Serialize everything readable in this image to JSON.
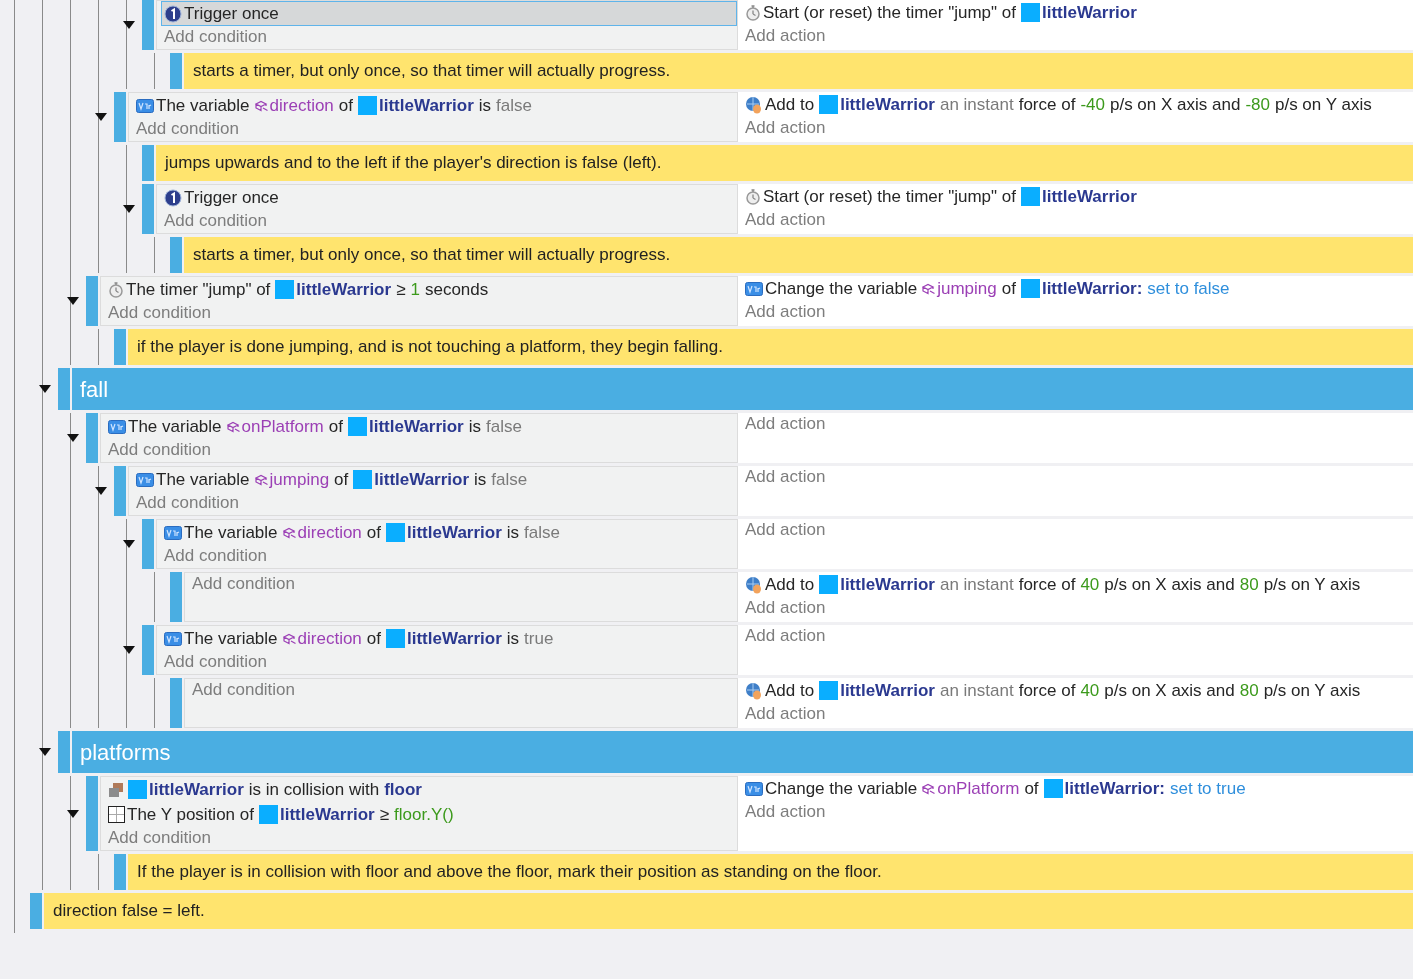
{
  "events": [
    {
      "children": [
        {
          "children": [
            {
              "children": [
                {
                  "children": [
                    {
                      "kind": "event",
                      "expanded": true,
                      "conditions": [
                        {
                          "kind": "trigger",
                          "selected": true,
                          "segments": [
                            {
                              "kind": "text",
                              "text": "Trigger once"
                            }
                          ]
                        }
                      ],
                      "add_condition": "Add condition",
                      "actions": [
                        {
                          "kind": "timer",
                          "selected": false,
                          "segments": [
                            {
                              "kind": "text",
                              "text": "Start (or reset) the timer \"jump\" of"
                            },
                            {
                              "kind": "object",
                              "text": "littleWarrior"
                            }
                          ]
                        }
                      ],
                      "add_action": "Add action",
                      "children": [
                        {
                          "kind": "comment",
                          "text": "starts a timer, but only once, so that timer will actually progress."
                        }
                      ]
                    }
                  ]
                },
                {
                  "kind": "event",
                  "expanded": true,
                  "conditions": [
                    {
                      "kind": "variable",
                      "selected": false,
                      "segments": [
                        {
                          "kind": "text",
                          "text": "The variable"
                        },
                        {
                          "kind": "variable",
                          "text": "direction"
                        },
                        {
                          "kind": "text",
                          "text": "of"
                        },
                        {
                          "kind": "object",
                          "text": "littleWarrior"
                        },
                        {
                          "kind": "text",
                          "text": "is"
                        },
                        {
                          "kind": "muted",
                          "text": "false"
                        }
                      ]
                    }
                  ],
                  "add_condition": "Add condition",
                  "actions": [
                    {
                      "kind": "force",
                      "selected": false,
                      "segments": [
                        {
                          "kind": "text",
                          "text": "Add to"
                        },
                        {
                          "kind": "object",
                          "text": "littleWarrior"
                        },
                        {
                          "kind": "muted",
                          "text": "an instant"
                        },
                        {
                          "kind": "text",
                          "text": "force of"
                        },
                        {
                          "kind": "number",
                          "text": "-40"
                        },
                        {
                          "kind": "text",
                          "text": "p/s on X axis and"
                        },
                        {
                          "kind": "number",
                          "text": "-80"
                        },
                        {
                          "kind": "text",
                          "text": "p/s on Y axis"
                        }
                      ]
                    }
                  ],
                  "add_action": "Add action",
                  "children": [
                    {
                      "kind": "comment",
                      "text": "jumps upwards and to the left if the player's direction is false (left)."
                    },
                    {
                      "kind": "event",
                      "expanded": true,
                      "conditions": [
                        {
                          "kind": "trigger",
                          "selected": false,
                          "segments": [
                            {
                              "kind": "text",
                              "text": "Trigger once"
                            }
                          ]
                        }
                      ],
                      "add_condition": "Add condition",
                      "actions": [
                        {
                          "kind": "timer",
                          "selected": false,
                          "segments": [
                            {
                              "kind": "text",
                              "text": "Start (or reset) the timer \"jump\" of"
                            },
                            {
                              "kind": "object",
                              "text": "littleWarrior"
                            }
                          ]
                        }
                      ],
                      "add_action": "Add action",
                      "children": [
                        {
                          "kind": "comment",
                          "text": "starts a timer, but only once, so that timer will actually progress."
                        }
                      ]
                    }
                  ]
                }
              ]
            },
            {
              "kind": "event",
              "expanded": true,
              "conditions": [
                {
                  "kind": "timer",
                  "selected": false,
                  "segments": [
                    {
                      "kind": "text",
                      "text": "The timer \"jump\" of"
                    },
                    {
                      "kind": "object",
                      "text": "littleWarrior"
                    },
                    {
                      "kind": "text",
                      "text": "≥"
                    },
                    {
                      "kind": "number",
                      "text": "1"
                    },
                    {
                      "kind": "text",
                      "text": "seconds"
                    }
                  ]
                }
              ],
              "add_condition": "Add condition",
              "actions": [
                {
                  "kind": "variable",
                  "selected": false,
                  "segments": [
                    {
                      "kind": "text",
                      "text": "Change the variable"
                    },
                    {
                      "kind": "variable",
                      "text": "jumping"
                    },
                    {
                      "kind": "text",
                      "text": "of"
                    },
                    {
                      "kind": "object",
                      "text": "littleWarrior:"
                    },
                    {
                      "kind": "value",
                      "text": "set to false"
                    }
                  ]
                }
              ],
              "add_action": "Add action",
              "children": [
                {
                  "kind": "comment",
                  "text": "if the player is done jumping, and is not touching a platform, they begin falling."
                }
              ]
            }
          ]
        },
        {
          "kind": "group",
          "text": "fall",
          "expanded": true,
          "children": [
            {
              "kind": "event",
              "expanded": true,
              "conditions": [
                {
                  "kind": "variable",
                  "selected": false,
                  "segments": [
                    {
                      "kind": "text",
                      "text": "The variable"
                    },
                    {
                      "kind": "variable",
                      "text": "onPlatform"
                    },
                    {
                      "kind": "text",
                      "text": "of"
                    },
                    {
                      "kind": "object",
                      "text": "littleWarrior"
                    },
                    {
                      "kind": "text",
                      "text": "is"
                    },
                    {
                      "kind": "muted",
                      "text": "false"
                    }
                  ]
                }
              ],
              "add_condition": "Add condition",
              "add_action": "Add action",
              "children": [
                {
                  "kind": "event",
                  "expanded": true,
                  "conditions": [
                    {
                      "kind": "variable",
                      "selected": false,
                      "segments": [
                        {
                          "kind": "text",
                          "text": "The variable"
                        },
                        {
                          "kind": "variable",
                          "text": "jumping"
                        },
                        {
                          "kind": "text",
                          "text": "of"
                        },
                        {
                          "kind": "object",
                          "text": "littleWarrior"
                        },
                        {
                          "kind": "text",
                          "text": "is"
                        },
                        {
                          "kind": "muted",
                          "text": "false"
                        }
                      ]
                    }
                  ],
                  "add_condition": "Add condition",
                  "add_action": "Add action",
                  "children": [
                    {
                      "kind": "event",
                      "expanded": true,
                      "conditions": [
                        {
                          "kind": "variable",
                          "selected": false,
                          "segments": [
                            {
                              "kind": "text",
                              "text": "The variable"
                            },
                            {
                              "kind": "variable",
                              "text": "direction"
                            },
                            {
                              "kind": "text",
                              "text": "of"
                            },
                            {
                              "kind": "object",
                              "text": "littleWarrior"
                            },
                            {
                              "kind": "text",
                              "text": "is"
                            },
                            {
                              "kind": "muted",
                              "text": "false"
                            }
                          ]
                        }
                      ],
                      "add_condition": "Add condition",
                      "add_action": "Add action",
                      "children": [
                        {
                          "kind": "event",
                          "add_condition": "Add condition",
                          "actions": [
                            {
                              "kind": "force",
                              "selected": false,
                              "segments": [
                                {
                                  "kind": "text",
                                  "text": "Add to"
                                },
                                {
                                  "kind": "object",
                                  "text": "littleWarrior"
                                },
                                {
                                  "kind": "muted",
                                  "text": "an instant"
                                },
                                {
                                  "kind": "text",
                                  "text": "force of"
                                },
                                {
                                  "kind": "number",
                                  "text": "40"
                                },
                                {
                                  "kind": "text",
                                  "text": "p/s on X axis and"
                                },
                                {
                                  "kind": "number",
                                  "text": "80"
                                },
                                {
                                  "kind": "text",
                                  "text": "p/s on Y axis"
                                }
                              ]
                            }
                          ],
                          "add_action": "Add action"
                        }
                      ]
                    },
                    {
                      "kind": "event",
                      "expanded": true,
                      "conditions": [
                        {
                          "kind": "variable",
                          "selected": false,
                          "segments": [
                            {
                              "kind": "text",
                              "text": "The variable"
                            },
                            {
                              "kind": "variable",
                              "text": "direction"
                            },
                            {
                              "kind": "text",
                              "text": "of"
                            },
                            {
                              "kind": "object",
                              "text": "littleWarrior"
                            },
                            {
                              "kind": "text",
                              "text": "is"
                            },
                            {
                              "kind": "muted",
                              "text": "true"
                            }
                          ]
                        }
                      ],
                      "add_condition": "Add condition",
                      "add_action": "Add action",
                      "children": [
                        {
                          "kind": "event",
                          "add_condition": "Add condition",
                          "actions": [
                            {
                              "kind": "force",
                              "selected": false,
                              "segments": [
                                {
                                  "kind": "text",
                                  "text": "Add to"
                                },
                                {
                                  "kind": "object",
                                  "text": "littleWarrior"
                                },
                                {
                                  "kind": "muted",
                                  "text": "an instant"
                                },
                                {
                                  "kind": "text",
                                  "text": "force of"
                                },
                                {
                                  "kind": "number",
                                  "text": "40"
                                },
                                {
                                  "kind": "text",
                                  "text": "p/s on X axis and"
                                },
                                {
                                  "kind": "number",
                                  "text": "80"
                                },
                                {
                                  "kind": "text",
                                  "text": "p/s on Y axis"
                                }
                              ]
                            }
                          ],
                          "add_action": "Add action"
                        }
                      ]
                    }
                  ]
                }
              ]
            }
          ]
        },
        {
          "kind": "group",
          "text": "platforms",
          "expanded": true,
          "children": [
            {
              "kind": "event",
              "expanded": true,
              "conditions": [
                {
                  "kind": "collision",
                  "selected": false,
                  "segments": [
                    {
                      "kind": "object",
                      "text": "littleWarrior"
                    },
                    {
                      "kind": "text",
                      "text": "is in collision with"
                    },
                    {
                      "kind": "objectref",
                      "text": "floor"
                    }
                  ]
                },
                {
                  "kind": "position",
                  "selected": false,
                  "segments": [
                    {
                      "kind": "text",
                      "text": "The Y position of"
                    },
                    {
                      "kind": "object",
                      "text": "littleWarrior"
                    },
                    {
                      "kind": "text",
                      "text": "≥"
                    },
                    {
                      "kind": "number",
                      "text": "floor.Y()"
                    }
                  ]
                }
              ],
              "add_condition": "Add condition",
              "actions": [
                {
                  "kind": "variable",
                  "selected": false,
                  "segments": [
                    {
                      "kind": "text",
                      "text": "Change the variable"
                    },
                    {
                      "kind": "variable",
                      "text": "onPlatform"
                    },
                    {
                      "kind": "text",
                      "text": "of"
                    },
                    {
                      "kind": "object",
                      "text": "littleWarrior:"
                    },
                    {
                      "kind": "value",
                      "text": "set to true"
                    }
                  ]
                }
              ],
              "add_action": "Add action",
              "children": [
                {
                  "kind": "comment",
                  "text": "If the player is in collision with floor and above the floor, mark their position as standing on the floor."
                }
              ]
            }
          ]
        }
      ]
    },
    {
      "kind": "comment",
      "text": "direction false = left."
    }
  ]
}
